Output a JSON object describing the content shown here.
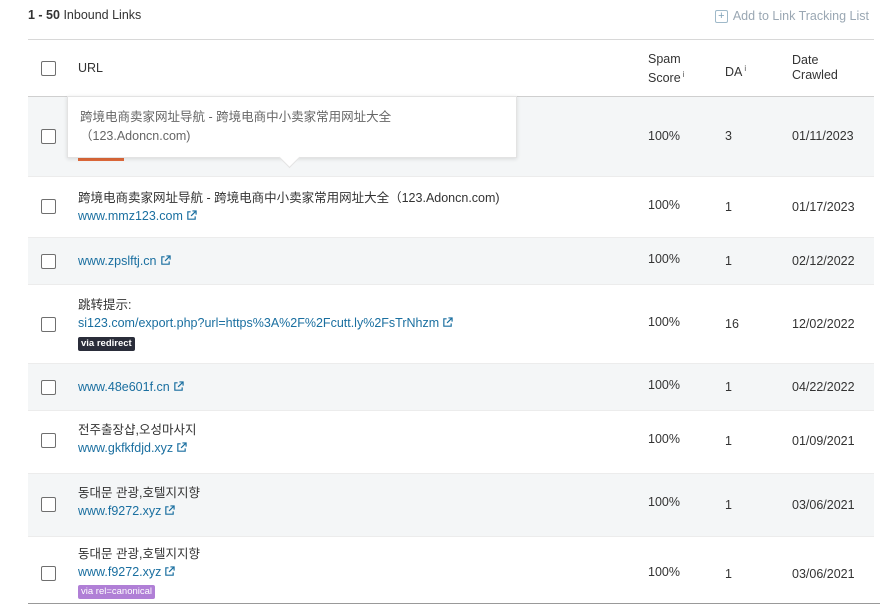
{
  "header": {
    "range": "1 - 50",
    "label": "Inbound Links",
    "add_tracking": "Add to Link Tracking List"
  },
  "columns": {
    "url": "URL",
    "spam_line1": "Spam",
    "spam_line2": "Score",
    "da": "DA",
    "date_line1": "Date",
    "date_line2": "Crawled",
    "info": "i"
  },
  "tooltip": {
    "line1": "跨境电商卖家网址导航 - 跨境电商中小卖家常用网址大全",
    "line2": "（123.Adoncn.com)"
  },
  "rows": [
    {
      "spam": "100%",
      "da": "3",
      "date": "01/11/2023"
    },
    {
      "title": "跨境电商卖家网址导航 - 跨境电商中小卖家常用网址大全（123.Adoncn.com)",
      "url": "www.mmz123.com",
      "spam": "100%",
      "da": "1",
      "date": "01/17/2023"
    },
    {
      "url": "www.zpslftj.cn",
      "spam": "100%",
      "da": "1",
      "date": "02/12/2022"
    },
    {
      "title": "跳转提示:",
      "url": "si123.com/export.php?url=https%3A%2F%2Fcutt.ly%2FsTrNhzm",
      "badge": "via redirect",
      "spam": "100%",
      "da": "16",
      "date": "12/02/2022"
    },
    {
      "url": "www.48e601f.cn",
      "spam": "100%",
      "da": "1",
      "date": "04/22/2022"
    },
    {
      "title": "전주출장샵,오성마사지",
      "url": "www.gkfkfdjd.xyz",
      "spam": "100%",
      "da": "1",
      "date": "01/09/2021"
    },
    {
      "title": "동대문 관광,호텔지지향",
      "url": "www.f9272.xyz",
      "spam": "100%",
      "da": "1",
      "date": "03/06/2021"
    },
    {
      "title": "동대문 관광,호텔지지향",
      "url": "www.f9272.xyz",
      "badge": "via rel=canonical",
      "spam": "100%",
      "da": "1",
      "date": "03/06/2021"
    }
  ],
  "colors": {
    "link": "#1a6fa0",
    "row_alt": "#f4f6f7",
    "badge_redirect": "#2a2d3a",
    "badge_canonical": "#b07fd6",
    "accent_bar": "#e06a3a"
  }
}
